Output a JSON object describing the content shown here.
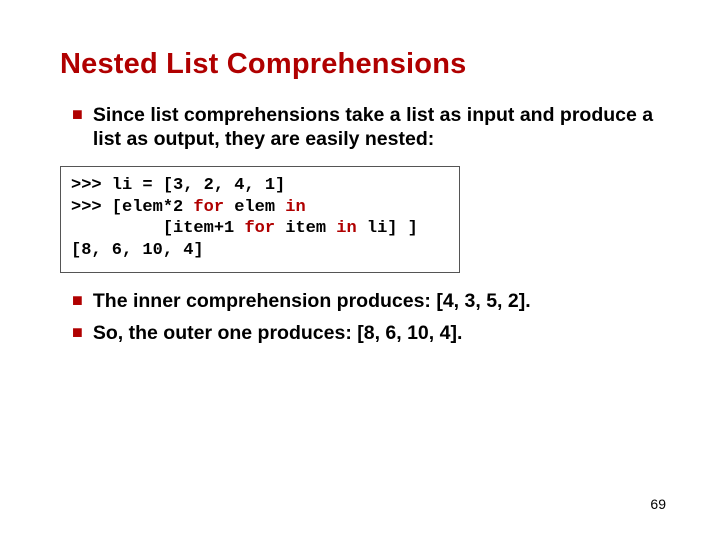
{
  "title": "Nested List Comprehensions",
  "bullets_top": [
    "Since list comprehensions take a list as input and produce a list as output, they are easily nested:"
  ],
  "code": {
    "l1a": ">>> li = [3, 2, 4, 1]",
    "l2a": ">>> [elem*2 ",
    "l2b": "for",
    "l2c": " elem ",
    "l2d": "in",
    "l3a": "         [item+1 ",
    "l3b": "for",
    "l3c": " item ",
    "l3d": "in",
    "l3e": " li] ]",
    "l4a": "[8, 6, 10, 4]"
  },
  "bullets_bottom": [
    "The inner comprehension produces: [4, 3, 5, 2].",
    "So, the outer one produces: [8, 6, 10, 4]."
  ],
  "page_number": "69"
}
